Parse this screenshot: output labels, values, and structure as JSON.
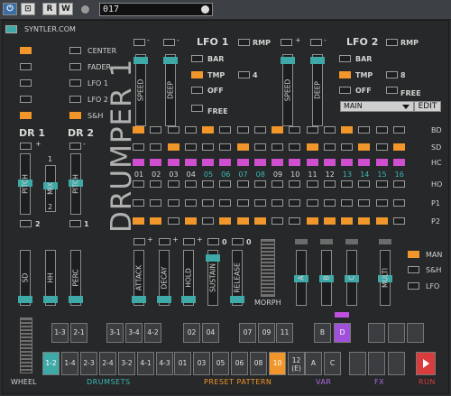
{
  "toolbar": {
    "power_label": "⏻",
    "compare_label": "⊡",
    "read_label": "R",
    "write_label": "W",
    "preset_value": "017"
  },
  "header": {
    "logo_text": "SYNTLER.COM",
    "title": "DRUMPER 1"
  },
  "center_options": [
    "CENTER",
    "FADER",
    "LFO 1",
    "LFO 2",
    "S&H"
  ],
  "lfo1": {
    "title": "LFO 1",
    "rmp": "RMP",
    "bar": "BAR",
    "tmp": "TMP",
    "off": "OFF",
    "free": "FREE",
    "rate_value": "4",
    "speed_label": "SPEED",
    "deep_label": "DEEP"
  },
  "lfo2": {
    "title": "LFO 2",
    "rmp": "RMP",
    "bar": "BAR",
    "tmp": "TMP",
    "off": "OFF",
    "free": "FREE",
    "rate_value": "8",
    "speed_label": "SPEED",
    "deep_label": "DEEP",
    "target_select": "MAIN",
    "edit_label": "EDIT"
  },
  "dr": {
    "dr1_label": "DR 1",
    "dr2_label": "DR 2",
    "pitch_label": "PITCH",
    "mix_label": "MIX",
    "mix_top": "1",
    "mix_bottom": "2",
    "val_2": "2",
    "val_1": "1"
  },
  "sequencer": {
    "rows": [
      "BD",
      "SD",
      "HC",
      "HO",
      "P1",
      "P2"
    ],
    "step_numbers": [
      "01",
      "02",
      "03",
      "04",
      "05",
      "06",
      "07",
      "08",
      "09",
      "10",
      "11",
      "12",
      "13",
      "14",
      "15",
      "16"
    ]
  },
  "envelope": {
    "attack": "ATTACK",
    "decay": "DECAY",
    "hold": "HOLD",
    "sustain": "SUSTAIN",
    "release": "RELEASE",
    "zero_a": "0",
    "zero_b": "0",
    "morph": "MORPH"
  },
  "sends": {
    "sd": "SD",
    "hh": "HH",
    "perc": "PERC"
  },
  "fx_sliders": {
    "a": "A",
    "b": "B",
    "c": "C",
    "multi": "MULTI"
  },
  "mod_source": [
    "MAN",
    "S&H",
    "LFO"
  ],
  "bottom": {
    "wheel": "WHEEL",
    "drumsets": "DRUMSETS",
    "preset_pattern": "PRESET  PATTERN",
    "var": "VAR",
    "fx": "FX",
    "run": "RUN",
    "drumset_top": [
      "1-3",
      "2-1",
      "3-1",
      "3-4",
      "4-2"
    ],
    "drumset_bottom": [
      "1-2",
      "1-4",
      "2-3",
      "2-4",
      "3-2",
      "4-1",
      "4-3"
    ],
    "pattern_top": [
      "02",
      "04",
      "07",
      "09",
      "11"
    ],
    "pattern_bottom": [
      "01",
      "03",
      "05",
      "06",
      "08",
      "10",
      "12\n(E)"
    ],
    "var_top": [
      "B",
      "D"
    ],
    "var_bottom": [
      "A",
      "C"
    ]
  },
  "colors": {
    "accent_orange": "#f0962a",
    "accent_teal": "#3fa9a8",
    "accent_purple": "#a050d8",
    "accent_pink": "#d04fd0",
    "run_red": "#d83c3c"
  }
}
